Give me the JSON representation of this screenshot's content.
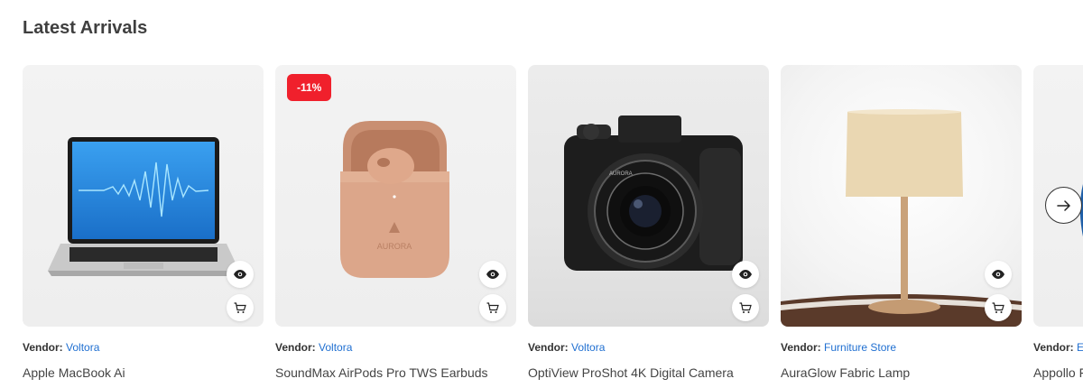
{
  "section": {
    "title": "Latest Arrivals"
  },
  "vendor_label": "Vendor:",
  "products": [
    {
      "vendor": "Voltora",
      "name": "Apple MacBook Ai",
      "badge": ""
    },
    {
      "vendor": "Voltora",
      "name": "SoundMax AirPods Pro TWS Earbuds",
      "badge": "-11%",
      "case_brand": "AURORA"
    },
    {
      "vendor": "Voltora",
      "name": "OptiView ProShot 4K Digital Camera",
      "badge": "",
      "camera_brand": "AURORA"
    },
    {
      "vendor": "Furniture Store",
      "name": "AuraGlow Fabric Lamp",
      "badge": ""
    },
    {
      "vendor": "E",
      "name": "Appollo F",
      "badge": ""
    }
  ],
  "colors": {
    "badge": "#f0202c",
    "vendor_link": "#1f6fd1"
  },
  "icons": {
    "view": "eye-icon",
    "cart": "cart-icon",
    "next": "arrow-right-icon"
  }
}
